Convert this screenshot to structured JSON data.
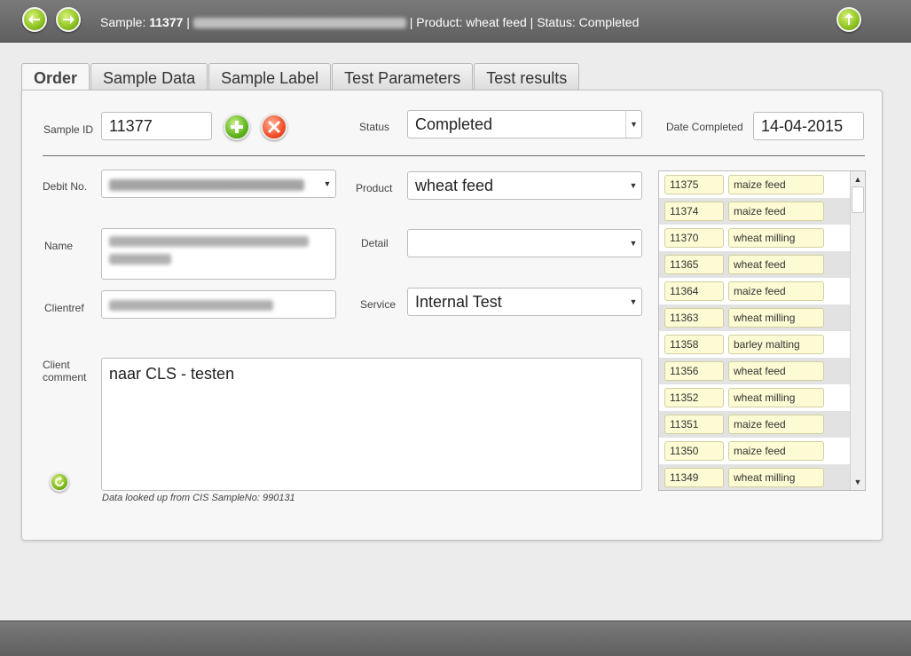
{
  "header": {
    "sample_prefix": "Sample: ",
    "sample_no": "11377",
    "separator": " | ",
    "product_status": " | Product: wheat feed | Status: Completed"
  },
  "tabs": [
    {
      "label": "Order",
      "active": true
    },
    {
      "label": "Sample Data",
      "active": false
    },
    {
      "label": "Sample Label",
      "active": false
    },
    {
      "label": "Test Parameters",
      "active": false
    },
    {
      "label": "Test results",
      "active": false
    }
  ],
  "form": {
    "sample_id_label": "Sample ID",
    "sample_id_value": "11377",
    "status_label": "Status",
    "status_value": "Completed",
    "date_completed_label": "Date Completed",
    "date_completed_value": "14-04-2015",
    "debit_label": "Debit No.",
    "product_label": "Product",
    "product_value": "wheat feed",
    "name_label": "Name",
    "detail_label": "Detail",
    "detail_value": "",
    "clientref_label": "Clientref",
    "service_label": "Service",
    "service_value": "Internal Test",
    "client_comment_label_1": "Client",
    "client_comment_label_2": "comment",
    "client_comment_value": "naar CLS - testen",
    "lookup_note": "Data looked up from CIS SampleNo: 990131"
  },
  "samples": [
    {
      "id": "11375",
      "product": "maize feed"
    },
    {
      "id": "11374",
      "product": "maize feed"
    },
    {
      "id": "11370",
      "product": "wheat milling"
    },
    {
      "id": "11365",
      "product": "wheat feed"
    },
    {
      "id": "11364",
      "product": "maize feed"
    },
    {
      "id": "11363",
      "product": "wheat milling"
    },
    {
      "id": "11358",
      "product": "barley malting"
    },
    {
      "id": "11356",
      "product": "wheat feed"
    },
    {
      "id": "11352",
      "product": "wheat milling"
    },
    {
      "id": "11351",
      "product": "maize feed"
    },
    {
      "id": "11350",
      "product": "maize feed"
    },
    {
      "id": "11349",
      "product": "wheat milling"
    }
  ],
  "colors": {
    "accent_green": "#8cc21f",
    "remove_red": "#f2502a",
    "list_cell": "#fdfbd4"
  }
}
